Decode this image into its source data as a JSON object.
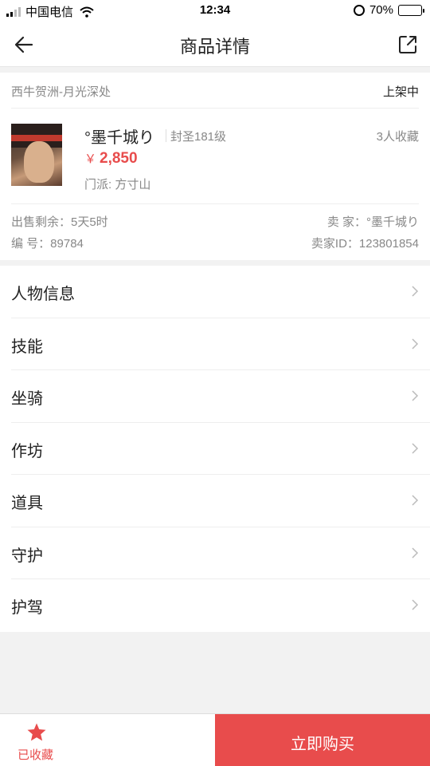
{
  "status_bar": {
    "carrier": "中国电信",
    "time": "12:34",
    "battery": "70%",
    "battery_level": 0.7
  },
  "nav": {
    "title": "商品详情"
  },
  "listing": {
    "server": "西牛贺洲-月光深处",
    "status": "上架中",
    "character_name": "°墨千城り",
    "level": "封圣181级",
    "favorites": "3人收藏",
    "price_symbol": "￥",
    "price": "2,850",
    "sect": "门派: 方寸山",
    "time_left": "出售剩余：5天5时",
    "seller": "卖 家：°墨千城り",
    "serial": "编 号：89784",
    "seller_id": "卖家ID：123801854"
  },
  "menu": {
    "items": [
      {
        "label": "人物信息"
      },
      {
        "label": "技能"
      },
      {
        "label": "坐骑"
      },
      {
        "label": "作坊"
      },
      {
        "label": "道具"
      },
      {
        "label": "守护"
      },
      {
        "label": "护驾"
      }
    ]
  },
  "bottom": {
    "favorite_label": "已收藏",
    "buy_label": "立即购买"
  },
  "colors": {
    "accent": "#e84c4c",
    "background": "#f2f2f2"
  }
}
